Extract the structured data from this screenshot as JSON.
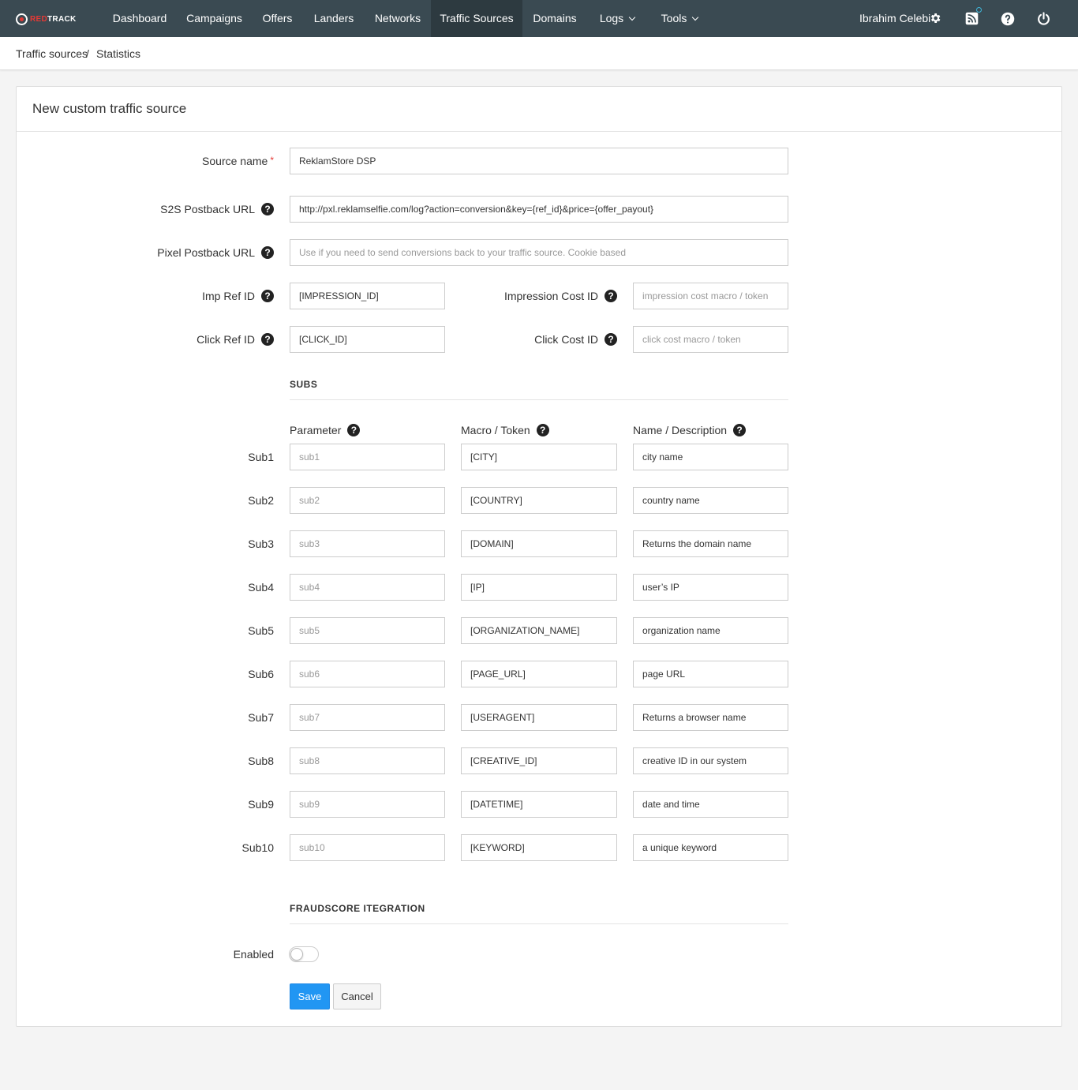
{
  "logo": {
    "text_red": "RED",
    "text_white": "TRACK"
  },
  "nav": {
    "items": [
      {
        "label": "Dashboard"
      },
      {
        "label": "Campaigns"
      },
      {
        "label": "Offers"
      },
      {
        "label": "Landers"
      },
      {
        "label": "Networks"
      },
      {
        "label": "Traffic Sources",
        "active": true
      },
      {
        "label": "Domains"
      },
      {
        "label": "Logs",
        "dropdown": true
      },
      {
        "label": "Tools",
        "dropdown": true
      }
    ],
    "user_name": "Ibrahim Celebi",
    "icons": [
      "gear-icon",
      "rss-icon",
      "help-icon",
      "power-icon"
    ]
  },
  "breadcrumb": {
    "item1": "Traffic sources",
    "separator": "/",
    "item2": "Statistics"
  },
  "panel": {
    "title": "New custom traffic source"
  },
  "form": {
    "source_name": {
      "label": "Source name",
      "required_mark": "*",
      "value": "ReklamStore DSP"
    },
    "s2s_postback": {
      "label": "S2S Postback URL",
      "value": "http://pxl.reklamselfie.com/log?action=conversion&key={ref_id}&price={offer_payout}"
    },
    "pixel_postback": {
      "label": "Pixel Postback URL",
      "placeholder": "Use if you need to send conversions back to your traffic source. Cookie based",
      "value": ""
    },
    "imp_ref_id": {
      "label": "Imp Ref ID",
      "value": "[IMPRESSION_ID]"
    },
    "impression_cost_id": {
      "label": "Impression Cost ID",
      "placeholder": "impression cost macro / token",
      "value": ""
    },
    "click_ref_id": {
      "label": "Click Ref ID",
      "value": "[CLICK_ID]"
    },
    "click_cost_id": {
      "label": "Click Cost ID",
      "placeholder": "click cost macro / token",
      "value": ""
    },
    "help_glyph": "?"
  },
  "subs": {
    "section_title": "SUBS",
    "col_parameter": "Parameter",
    "col_macro": "Macro / Token",
    "col_name": "Name / Description",
    "rows": [
      {
        "label": "Sub1",
        "param_placeholder": "sub1",
        "macro": "[CITY]",
        "name": "city name"
      },
      {
        "label": "Sub2",
        "param_placeholder": "sub2",
        "macro": "[COUNTRY]",
        "name": "country name"
      },
      {
        "label": "Sub3",
        "param_placeholder": "sub3",
        "macro": "[DOMAIN]",
        "name": "Returns the domain name"
      },
      {
        "label": "Sub4",
        "param_placeholder": "sub4",
        "macro": "[IP]",
        "name": "user’s IP"
      },
      {
        "label": "Sub5",
        "param_placeholder": "sub5",
        "macro": "[ORGANIZATION_NAME]",
        "name": "organization name"
      },
      {
        "label": "Sub6",
        "param_placeholder": "sub6",
        "macro": "[PAGE_URL]",
        "name": "page URL"
      },
      {
        "label": "Sub7",
        "param_placeholder": "sub7",
        "macro": "[USERAGENT]",
        "name": "Returns a browser name"
      },
      {
        "label": "Sub8",
        "param_placeholder": "sub8",
        "macro": "[CREATIVE_ID]",
        "name": "creative ID in our system"
      },
      {
        "label": "Sub9",
        "param_placeholder": "sub9",
        "macro": "[DATETIME]",
        "name": "date and time"
      },
      {
        "label": "Sub10",
        "param_placeholder": "sub10",
        "macro": "[KEYWORD]",
        "name": "a unique keyword"
      }
    ]
  },
  "fraudscore": {
    "section_title": "FRAUDSCORE ITEGRATION",
    "enabled_label": "Enabled",
    "enabled": false
  },
  "actions": {
    "save_label": "Save",
    "cancel_label": "Cancel"
  },
  "colors": {
    "navbar": "#3a4a52",
    "navbar_active": "#2d3a40",
    "primary": "#2196f3",
    "required": "#e53935",
    "notification": "#3fb5d8"
  }
}
